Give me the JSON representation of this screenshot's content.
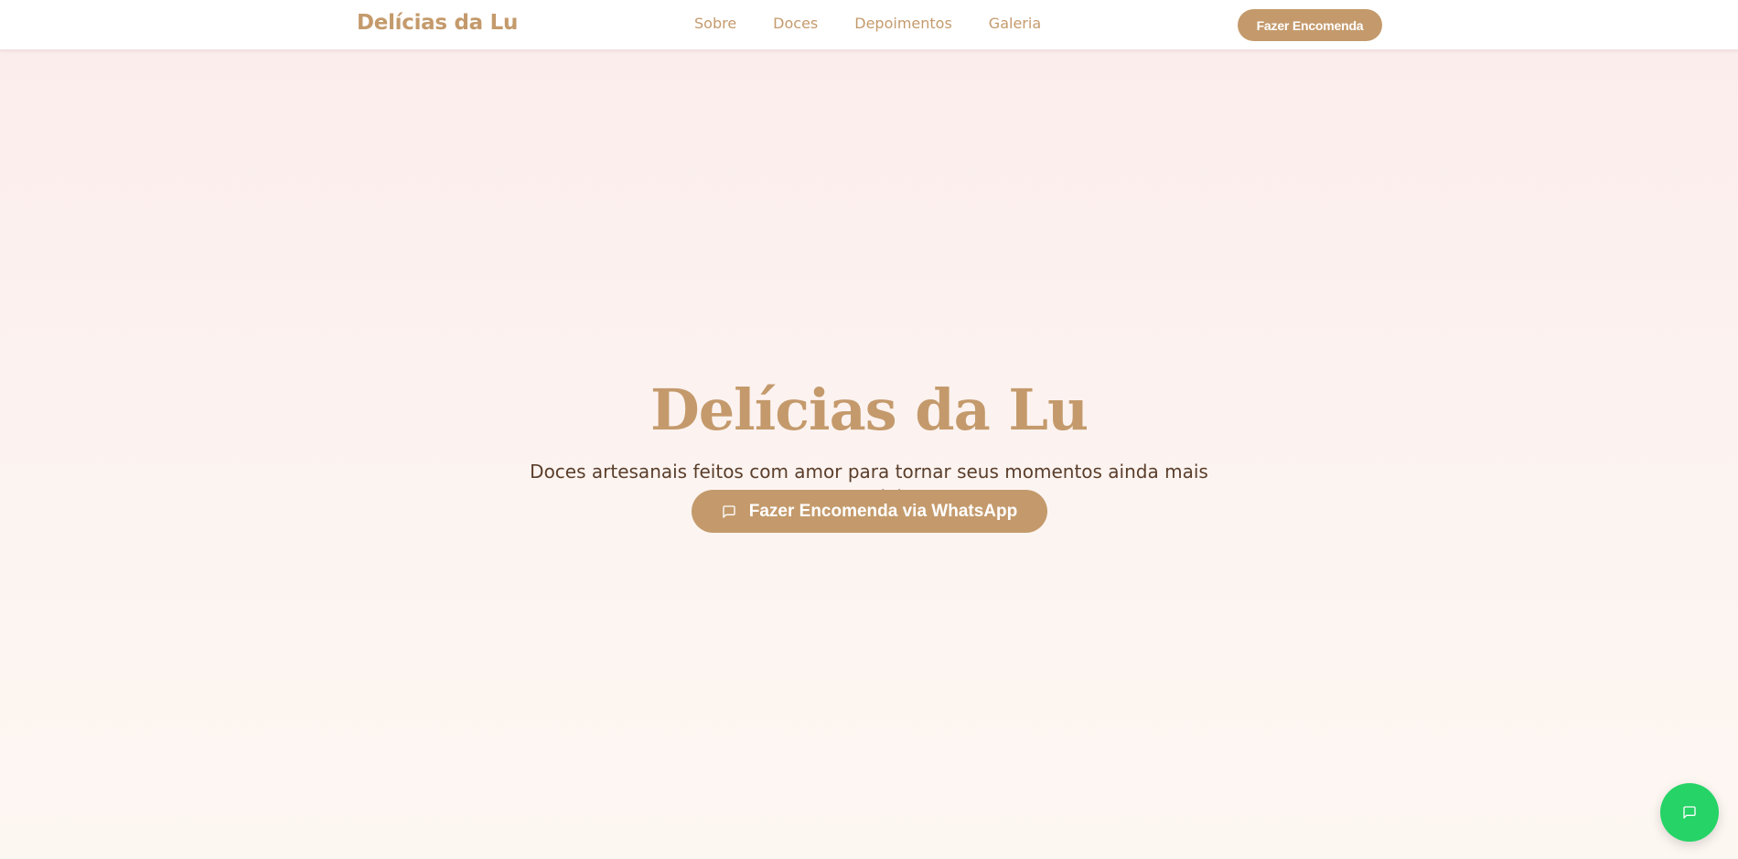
{
  "navbar": {
    "brand": "Delícias da Lu",
    "links": [
      {
        "label": "Sobre"
      },
      {
        "label": "Doces"
      },
      {
        "label": "Depoimentos"
      },
      {
        "label": "Galeria"
      }
    ],
    "cta_label": "Fazer Encomenda"
  },
  "hero": {
    "title": "Delícias da Lu",
    "subtitle": "Doces artesanais feitos com amor para tornar seus momentos ainda mais especiais",
    "cta_label": "Fazer Encomenda via WhatsApp",
    "cta_icon": "message-square-icon"
  },
  "floating_button": {
    "icon": "message-square-icon"
  },
  "colors": {
    "accent": "#c49a6c",
    "text_dark": "#5a3e2b",
    "whatsapp": "#25d366",
    "bg_top": "#fbeceb",
    "bg_bottom": "#fdf7f2"
  }
}
